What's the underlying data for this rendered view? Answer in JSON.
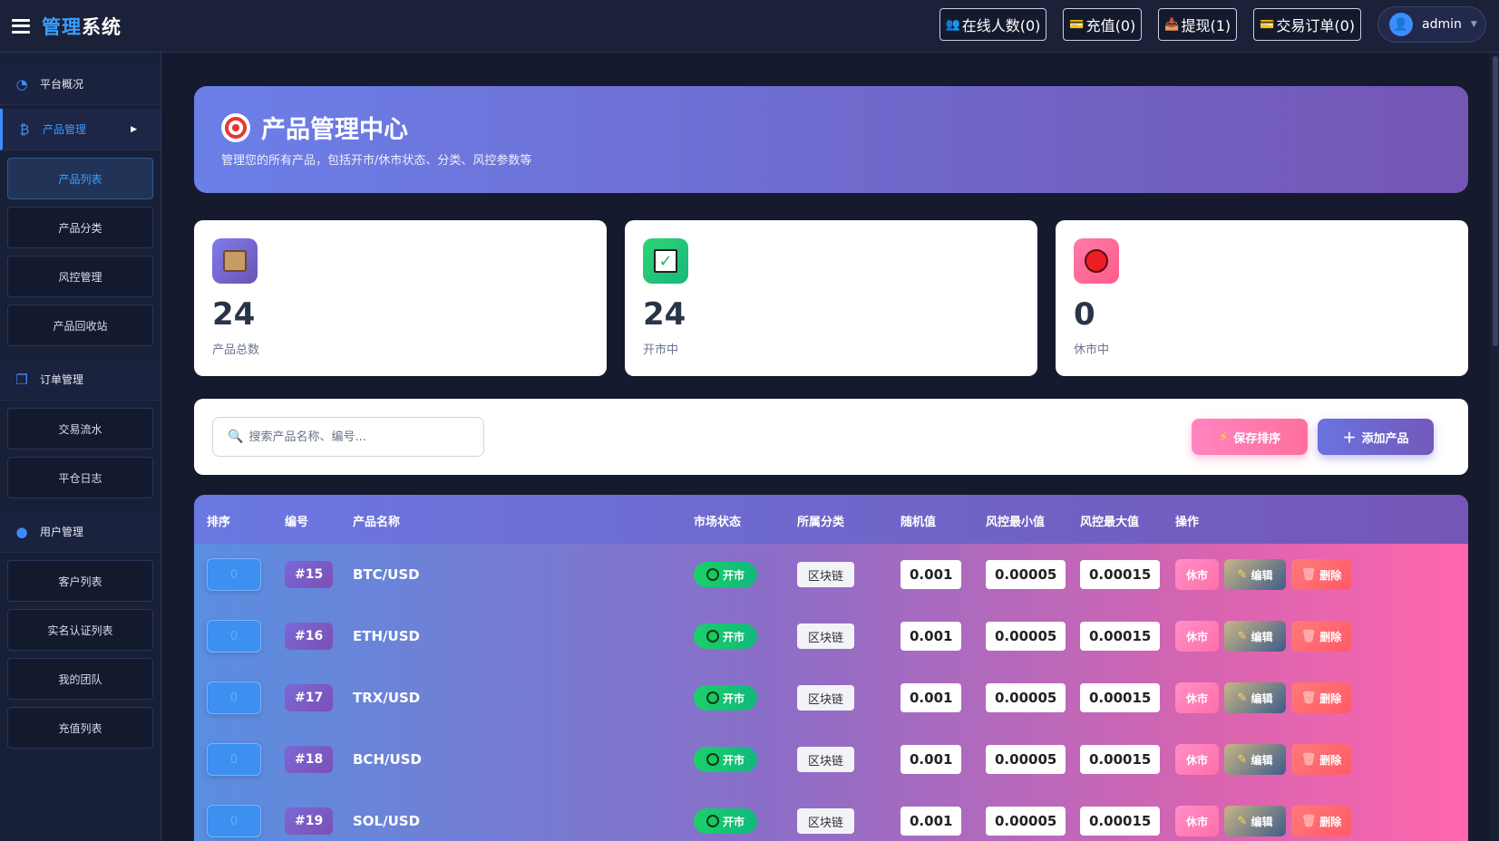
{
  "brand": {
    "part1": "管理",
    "part2": "系统"
  },
  "topbar": {
    "online": "在线人数(0)",
    "recharge": "充值(0)",
    "withdraw": "提现(1)",
    "orders": "交易订单(0)",
    "user": "admin"
  },
  "sidebar": {
    "sections": [
      {
        "label": "平台概况",
        "icon": "dashboard-icon",
        "items": []
      },
      {
        "label": "产品管理",
        "icon": "bitcoin-icon",
        "active": true,
        "items": [
          "产品列表",
          "产品分类",
          "风控管理",
          "产品回收站"
        ]
      },
      {
        "label": "订单管理",
        "icon": "copy-icon",
        "items": [
          "交易流水",
          "平仓日志"
        ]
      },
      {
        "label": "用户管理",
        "icon": "user-icon",
        "items": [
          "客户列表",
          "实名认证列表",
          "我的团队",
          "充值列表"
        ]
      }
    ]
  },
  "hero": {
    "title": "产品管理中心",
    "subtitle": "管理您的所有产品，包括开市/休市状态、分类、风控参数等"
  },
  "stats": [
    {
      "value": "24",
      "label": "产品总数"
    },
    {
      "value": "24",
      "label": "开市中"
    },
    {
      "value": "0",
      "label": "休市中"
    }
  ],
  "toolbar": {
    "search_placeholder": "搜索产品名称、编号...",
    "save_label": "保存排序",
    "add_label": "添加产品"
  },
  "table": {
    "headers": [
      "排序",
      "编号",
      "产品名称",
      "市场状态",
      "所属分类",
      "随机值",
      "风控最小值",
      "风控最大值",
      "操作"
    ],
    "rows": [
      {
        "sort": "0",
        "id": "#15",
        "name": "BTC/USD",
        "status": "开市",
        "category": "区块链",
        "random": "0.001",
        "min": "0.00005",
        "max": "0.00015"
      },
      {
        "sort": "0",
        "id": "#16",
        "name": "ETH/USD",
        "status": "开市",
        "category": "区块链",
        "random": "0.001",
        "min": "0.00005",
        "max": "0.00015"
      },
      {
        "sort": "0",
        "id": "#17",
        "name": "TRX/USD",
        "status": "开市",
        "category": "区块链",
        "random": "0.001",
        "min": "0.00005",
        "max": "0.00015"
      },
      {
        "sort": "0",
        "id": "#18",
        "name": "BCH/USD",
        "status": "开市",
        "category": "区块链",
        "random": "0.001",
        "min": "0.00005",
        "max": "0.00015"
      },
      {
        "sort": "0",
        "id": "#19",
        "name": "SOL/USD",
        "status": "开市",
        "category": "区块链",
        "random": "0.001",
        "min": "0.00005",
        "max": "0.00015"
      }
    ],
    "actions": {
      "close": "休市",
      "edit": "编辑",
      "delete": "删除"
    }
  }
}
